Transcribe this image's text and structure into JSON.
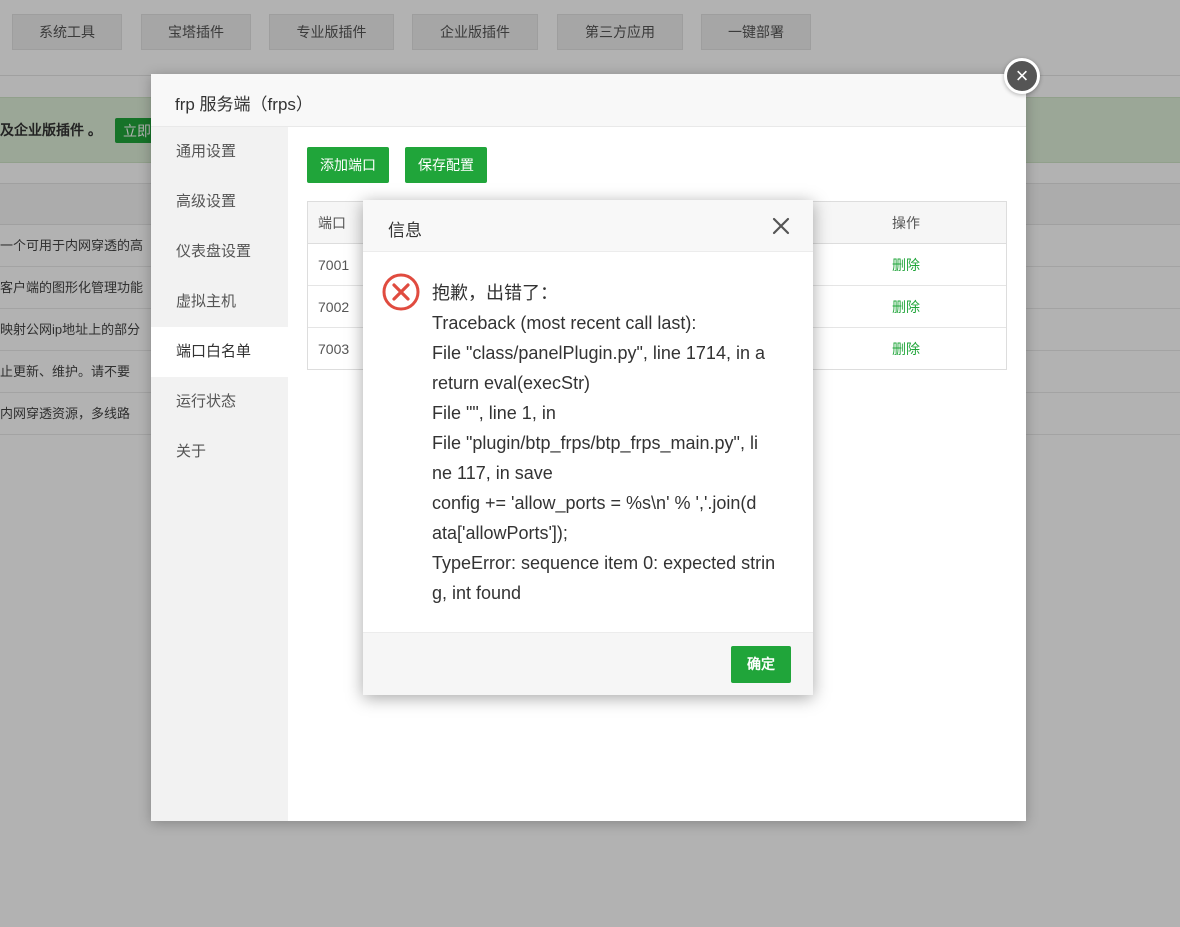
{
  "top_tabs": [
    "系统工具",
    "宝塔插件",
    "专业版插件",
    "企业版插件",
    "第三方应用",
    "一键部署"
  ],
  "promo": {
    "text": "及企业版插件 。",
    "button": "立即"
  },
  "bg_rows": [
    "一个可用于内网穿透的高",
    "客户端的图形化管理功能",
    "映射公网ip地址上的部分",
    "止更新、维护。请不要",
    "内网穿透资源，多线路"
  ],
  "panel": {
    "title": "frp 服务端（frps）",
    "sidebar": [
      "通用设置",
      "高级设置",
      "仪表盘设置",
      "虚拟主机",
      "端口白名单",
      "运行状态",
      "关于"
    ],
    "active_index": 4,
    "buttons": {
      "add": "添加端口",
      "save": "保存配置"
    },
    "table": {
      "headers": {
        "port": "端口",
        "action": "操作"
      },
      "rows": [
        {
          "port": "7001",
          "action": "删除"
        },
        {
          "port": "7002",
          "action": "删除"
        },
        {
          "port": "7003",
          "action": "删除"
        }
      ]
    }
  },
  "dialog": {
    "title": "信息",
    "lines": [
      "抱歉，出错了：",
      "Traceback (most recent call last):",
      "File \"class/panelPlugin.py\", line 1714, in a",
      "return eval(execStr)",
      "File \"\", line 1, in",
      "File \"plugin/btp_frps/btp_frps_main.py\", li",
      "ne 117, in save",
      "config += 'allow_ports = %s\\n' % ','.join(d",
      "ata['allowPorts']);",
      "TypeError: sequence item 0: expected strin",
      "g, int found"
    ],
    "ok": "确定"
  },
  "colors": {
    "accent": "#20a53a",
    "error": "#e04b3f",
    "overlay": "rgba(0,0,0,0.30)"
  }
}
